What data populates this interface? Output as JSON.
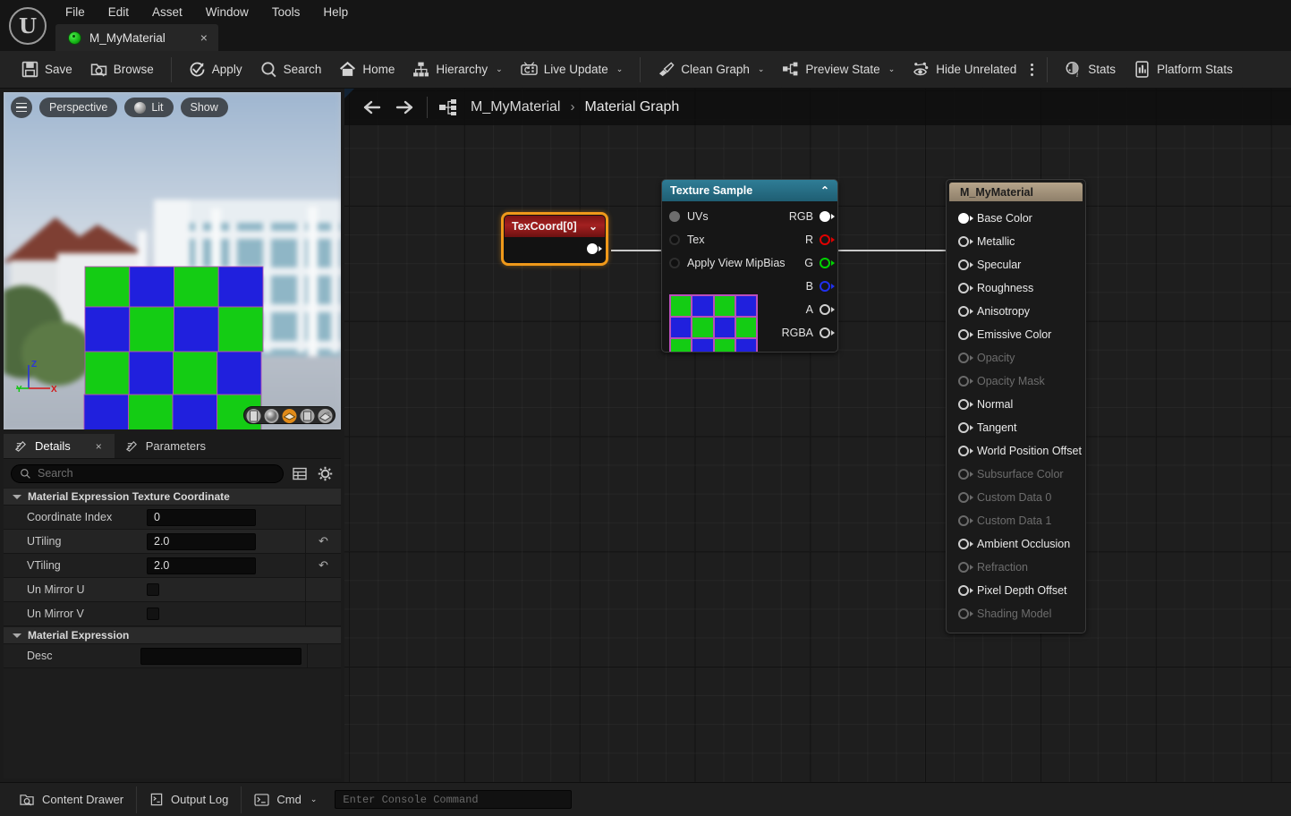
{
  "menu": {
    "items": [
      "File",
      "Edit",
      "Asset",
      "Window",
      "Tools",
      "Help"
    ]
  },
  "tab": {
    "label": "M_MyMaterial",
    "close": "×",
    "icon": "material-sphere-icon"
  },
  "toolbar": {
    "groups": [
      [
        {
          "label": "Save",
          "icon": "save-icon",
          "caret": false
        },
        {
          "label": "Browse",
          "icon": "browse-icon",
          "caret": false
        }
      ],
      [
        {
          "label": "Apply",
          "icon": "apply-icon",
          "caret": false
        },
        {
          "label": "Search",
          "icon": "search-icon",
          "caret": false
        },
        {
          "label": "Home",
          "icon": "home-icon",
          "caret": false
        },
        {
          "label": "Hierarchy",
          "icon": "hierarchy-icon",
          "caret": true
        },
        {
          "label": "Live Update",
          "icon": "live-update-icon",
          "caret": true
        }
      ],
      [
        {
          "label": "Clean Graph",
          "icon": "clean-graph-icon",
          "caret": true
        },
        {
          "label": "Preview State",
          "icon": "preview-state-icon",
          "caret": true
        },
        {
          "label": "Hide Unrelated",
          "icon": "hide-unrelated-icon",
          "caret": false
        }
      ],
      [
        {
          "label": "Stats",
          "icon": "stats-icon",
          "caret": false
        },
        {
          "label": "Platform Stats",
          "icon": "platform-stats-icon",
          "caret": false
        }
      ]
    ]
  },
  "viewport": {
    "menu_icon": "hamburger-icon",
    "pills": [
      {
        "label": "Perspective",
        "icon": ""
      },
      {
        "label": "Lit",
        "icon": "lit-sphere-icon"
      },
      {
        "label": "Show",
        "icon": ""
      }
    ],
    "axes": {
      "x": "X",
      "y": "Y",
      "z": "Z"
    },
    "shapes": [
      "cylinder",
      "sphere",
      "plane",
      "cube",
      "custom-mesh"
    ],
    "selected_shape_index": 2,
    "shape_colors": {
      "selected": "#e08a18",
      "normal": "#9a9a9a"
    },
    "preview_checker": {
      "color_a": "#14cc14",
      "color_b": "#2020dd",
      "edge": "#b84fb8"
    }
  },
  "details": {
    "tabs": [
      {
        "label": "Details",
        "active": true,
        "closeable": true
      },
      {
        "label": "Parameters",
        "active": false,
        "closeable": false
      }
    ],
    "close_glyph": "×",
    "search_placeholder": "Search",
    "icons": [
      "table-view-icon",
      "settings-gear-icon"
    ],
    "sections": [
      {
        "title": "Material Expression Texture Coordinate",
        "rows": [
          {
            "label": "Coordinate Index",
            "type": "text",
            "value": "0",
            "reset": false
          },
          {
            "label": "UTiling",
            "type": "text",
            "value": "2.0",
            "reset": true
          },
          {
            "label": "VTiling",
            "type": "text",
            "value": "2.0",
            "reset": true
          },
          {
            "label": "Un Mirror U",
            "type": "checkbox",
            "value": "",
            "checked": false,
            "reset": false
          },
          {
            "label": "Un Mirror V",
            "type": "checkbox",
            "value": "",
            "checked": false,
            "reset": false
          }
        ]
      },
      {
        "title": "Material Expression",
        "rows": [
          {
            "label": "Desc",
            "type": "text-wide",
            "value": "",
            "reset": false
          }
        ]
      }
    ],
    "reset_glyph": "↶"
  },
  "graph": {
    "back_glyph": "←",
    "forward_glyph": "→",
    "graph_icon": "material-graph-icon",
    "breadcrumb": [
      "M_MyMaterial",
      "Material Graph"
    ],
    "breadcrumb_sep": "›",
    "nodes": {
      "texcoord": {
        "title": "TexCoord[0]",
        "collapse_glyph": "⌄",
        "selected": true,
        "border_color": "#f0991a",
        "header_color": "#a32020",
        "output_pin": "uv-output-pin"
      },
      "texture_sample": {
        "title": "Texture Sample",
        "collapse_glyph": "⌃",
        "header_color": "#2f7d96",
        "inputs": [
          {
            "label": "UVs",
            "state": "connected"
          },
          {
            "label": "Tex",
            "state": "empty"
          },
          {
            "label": "Apply View MipBias",
            "state": "empty"
          }
        ],
        "outputs": [
          {
            "label": "RGB",
            "color": "#ffffff",
            "state": "connected"
          },
          {
            "label": "R",
            "color": "#e00000",
            "state": "open"
          },
          {
            "label": "G",
            "color": "#00d400",
            "state": "open"
          },
          {
            "label": "B",
            "color": "#2030ee",
            "state": "open"
          },
          {
            "label": "A",
            "color": "#cfcfcf",
            "state": "open"
          },
          {
            "label": "RGBA",
            "color": "#cfcfcf",
            "state": "open"
          }
        ]
      },
      "material_output": {
        "title": "M_MyMaterial",
        "header_color": "#b7a58b",
        "pins": [
          {
            "label": "Base Color",
            "enabled": true,
            "connected": true
          },
          {
            "label": "Metallic",
            "enabled": true,
            "connected": false
          },
          {
            "label": "Specular",
            "enabled": true,
            "connected": false
          },
          {
            "label": "Roughness",
            "enabled": true,
            "connected": false
          },
          {
            "label": "Anisotropy",
            "enabled": true,
            "connected": false
          },
          {
            "label": "Emissive Color",
            "enabled": true,
            "connected": false
          },
          {
            "label": "Opacity",
            "enabled": false,
            "connected": false
          },
          {
            "label": "Opacity Mask",
            "enabled": false,
            "connected": false
          },
          {
            "label": "Normal",
            "enabled": true,
            "connected": false
          },
          {
            "label": "Tangent",
            "enabled": true,
            "connected": false
          },
          {
            "label": "World Position Offset",
            "enabled": true,
            "connected": false
          },
          {
            "label": "Subsurface Color",
            "enabled": false,
            "connected": false
          },
          {
            "label": "Custom Data 0",
            "enabled": false,
            "connected": false
          },
          {
            "label": "Custom Data 1",
            "enabled": false,
            "connected": false
          },
          {
            "label": "Ambient Occlusion",
            "enabled": true,
            "connected": false
          },
          {
            "label": "Refraction",
            "enabled": false,
            "connected": false
          },
          {
            "label": "Pixel Depth Offset",
            "enabled": true,
            "connected": false
          },
          {
            "label": "Shading Model",
            "enabled": false,
            "connected": false
          }
        ]
      }
    }
  },
  "statusbar": {
    "content_drawer": "Content Drawer",
    "output_log": "Output Log",
    "cmd": "Cmd",
    "cmd_caret": "⌄",
    "console_placeholder": "Enter Console Command"
  }
}
